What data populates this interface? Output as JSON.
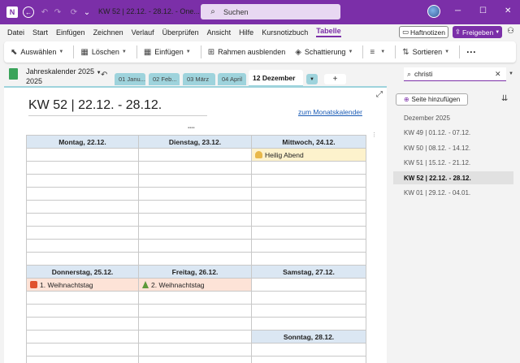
{
  "window": {
    "title": "KW 52 | 22.12. - 28.12. - One...",
    "search_placeholder": "Suchen",
    "btn_minimize": "─",
    "btn_maximize": "☐",
    "btn_close": "✕"
  },
  "menu": [
    "Datei",
    "Start",
    "Einfügen",
    "Zeichnen",
    "Verlauf",
    "Überprüfen",
    "Ansicht",
    "Hilfe",
    "Kursnotizbuch",
    "Tabelle"
  ],
  "menu_active": "Tabelle",
  "header_buttons": {
    "haftnotizen": "Haftnotizen",
    "freigeben": "Freigeben"
  },
  "ribbon": {
    "auswaehlen": "Auswählen",
    "loeschen": "Löschen",
    "einfuegen": "Einfügen",
    "rahmen": "Rahmen ausblenden",
    "schattierung": "Schattierung",
    "sortieren": "Sortieren",
    "more": "···"
  },
  "notebook": {
    "name_line1": "Jahreskalender 2025",
    "name_line2": "2025"
  },
  "tabs": [
    "01 Janu...",
    "02 Feb...",
    "03 März",
    "04 April",
    "12 Dezember"
  ],
  "tab_add": "+",
  "find": {
    "value": "christi"
  },
  "page": {
    "title": "KW 52 | 22.12. - 28.12.",
    "link": "zum Monatskalender"
  },
  "calendar": {
    "row1_headers": [
      "Montag, 22.12.",
      "Dienstag, 23.12.",
      "Mittwoch, 24.12."
    ],
    "row1_events": {
      "mittwoch": "Heilig Abend"
    },
    "row2_headers": [
      "Donnerstag, 25.12.",
      "Freitag, 26.12.",
      "Samstag, 27.12."
    ],
    "row2_events": {
      "donnerstag": "1. Weihnachtstag",
      "freitag": "2. Weihnachtstag"
    },
    "sunday_header": "Sonntag, 28.12."
  },
  "right_pane": {
    "add_page": "Seite hinzufügen",
    "pages": [
      "Dezember 2025",
      "KW 49 | 01.12. - 07.12.",
      "KW 50 | 08.12. - 14.12.",
      "KW 51 | 15.12. - 21.12.",
      "KW 52 | 22.12. - 28.12.",
      "KW 01 | 29.12. - 04.01."
    ],
    "active_index": 4
  },
  "colors": {
    "accent": "#7b2fa8",
    "tab_color": "#9ed3dc",
    "header_cell": "#dbe7f3",
    "event_yellow": "#fdf2cc",
    "event_red": "#fde3d7",
    "link": "#1a5bb5"
  }
}
